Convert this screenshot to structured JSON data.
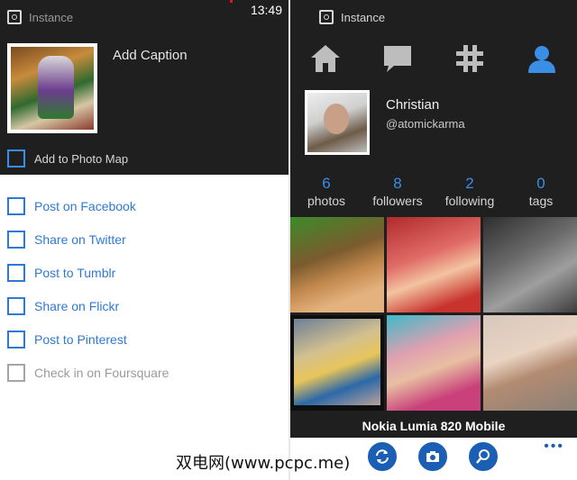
{
  "status_bar": {
    "time": "13:49"
  },
  "left": {
    "app_name": "Instance",
    "caption_placeholder": "Add Caption",
    "photo_map_label": "Add to Photo Map",
    "share_options": [
      {
        "label": "Post on Facebook",
        "enabled": true
      },
      {
        "label": "Share on Twitter",
        "enabled": true
      },
      {
        "label": "Post to Tumblr",
        "enabled": true
      },
      {
        "label": "Share on Flickr",
        "enabled": true
      },
      {
        "label": "Post to Pinterest",
        "enabled": true
      },
      {
        "label": "Check in on Foursquare",
        "enabled": false
      }
    ]
  },
  "right": {
    "app_name": "Instance",
    "nav": [
      "home-icon",
      "comment-icon",
      "hashtag-icon",
      "profile-icon"
    ],
    "profile": {
      "name": "Christian",
      "handle": "@atomickarma"
    },
    "stats": [
      {
        "value": "6",
        "label": "photos"
      },
      {
        "value": "8",
        "label": "followers"
      },
      {
        "value": "2",
        "label": "following"
      },
      {
        "value": "0",
        "label": "tags"
      }
    ],
    "device_caption": "Nokia Lumia 820 Mobile",
    "app_bar": [
      "refresh-icon",
      "camera-icon",
      "search-icon"
    ],
    "more": "•••"
  },
  "watermark": "双电网(www.pcpc.me)",
  "colors": {
    "accent": "#3a8ee6",
    "dark_bg": "#1f1f1f",
    "appbar_accent": "#1a5fb4"
  }
}
